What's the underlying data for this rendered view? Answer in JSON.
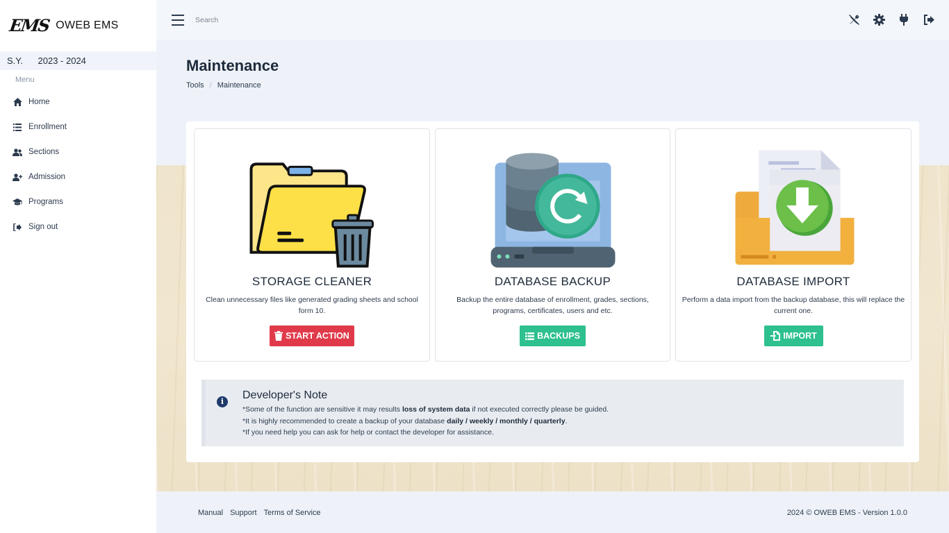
{
  "brand": {
    "logo": "EMS",
    "name": "OWEB EMS"
  },
  "school_year": {
    "label": "S.Y.",
    "value": "2023 - 2024"
  },
  "sidebar": {
    "menu_label": "Menu",
    "items": [
      {
        "label": "Home",
        "icon": "home-icon"
      },
      {
        "label": "Enrollment",
        "icon": "list-icon"
      },
      {
        "label": "Sections",
        "icon": "users-icon"
      },
      {
        "label": "Admission",
        "icon": "user-plus-icon"
      },
      {
        "label": "Programs",
        "icon": "graduation-cap-icon"
      },
      {
        "label": "Sign out",
        "icon": "sign-out-icon"
      }
    ]
  },
  "topbar": {
    "search_placeholder": "Search",
    "icons": [
      "tools-icon",
      "gear-icon",
      "plug-icon",
      "logout-icon"
    ]
  },
  "page": {
    "title": "Maintenance",
    "breadcrumb": [
      "Tools",
      "Maintenance"
    ]
  },
  "tools": [
    {
      "title": "STORAGE CLEANER",
      "description": "Clean unnecessary files like generated grading sheets and school form 10.",
      "button": "START ACTION",
      "button_icon": "trash-icon",
      "button_color": "#e03a4a"
    },
    {
      "title": "DATABASE BACKUP",
      "description": "Backup the entire database of enrollment, grades, sections, programs, certificates, users and etc.",
      "button": "BACKUPS",
      "button_icon": "list-icon",
      "button_color": "#2ec08e"
    },
    {
      "title": "DATABASE IMPORT",
      "description": "Perform a data import from the backup database, this will replace the current one.",
      "button": "IMPORT",
      "button_icon": "file-import-icon",
      "button_color": "#2ec08e"
    }
  ],
  "developer_note": {
    "title": "Developer's Note",
    "line1_pre": "*Some of the function are sensitive it may results ",
    "line1_bold": "loss of system data",
    "line1_post": " if not executed correctly please be guided.",
    "line2_pre": "*It is highly recommended to create a backup of your database ",
    "line2_bold": "daily / weekly / monthly / quarterly",
    "line2_post": ".",
    "line3": "*If you need help you can ask for help or contact the developer for assistance."
  },
  "footer": {
    "links": [
      "Manual",
      "Support",
      "Terms of Service"
    ],
    "copyright": "2024 © OWEB EMS - Version 1.0.0"
  }
}
